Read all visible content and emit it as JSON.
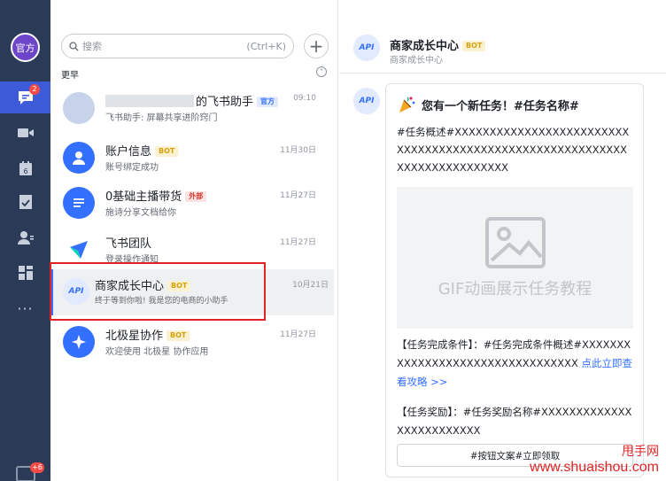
{
  "rail": {
    "avatar_text": "官方",
    "chat_badge": "2",
    "more_dots": "···",
    "bottom_badge": "+6"
  },
  "list": {
    "search_placeholder": "搜索",
    "search_shortcut": "(Ctrl+K)",
    "add_symbol": "+",
    "section_label": "更早",
    "items": [
      {
        "name": "的飞书助手",
        "tag": "官方",
        "preview": "飞书助手: 屏幕共享进阶窍门",
        "time": "09:10"
      },
      {
        "name": "账户信息",
        "tag": "BOT",
        "preview": "账号绑定成功",
        "time": "11月30日"
      },
      {
        "name": "0基础主播带货",
        "tag": "外部",
        "preview": "施诗分享文档给你",
        "time": "11月27日"
      },
      {
        "name": "飞书团队",
        "tag": "",
        "preview": "登录操作通知",
        "time": "11月27日"
      },
      {
        "name": "商家成长中心",
        "tag": "BOT",
        "preview": "终于等到你啦! 我是您的电商的小助手",
        "time": "10月21日"
      },
      {
        "name": "北极星协作",
        "tag": "BOT",
        "preview": "欢迎使用 北极星 协作应用",
        "time": "11月27日"
      }
    ]
  },
  "chat": {
    "avatar_text": "API",
    "title": "商家成长中心",
    "title_tag": "BOT",
    "subtitle": "商家成长中心",
    "card": {
      "title": "您有一个新任务！#任务名称#",
      "overview": "#任务概述#XXXXXXXXXXXXXXXXXXXXXXXXXXXXXXXXXXXXXXXXXXXXXXXXXXXXXXXXXXXXXXXXXXXXXXXXXX",
      "gif_text": "GIF动画展示任务教程",
      "condition_label": "【任务完成条件】：#任务完成条件概述#XXXXXXXXXXXXXXXXXXXXXXXXXXXXXXXXX",
      "condition_link": "点此立即查看攻略 >>",
      "reward_label": "【任务奖励】：#任务奖励名称#XXXXXXXXXXXXXXXXXXXXXXXXX",
      "button_label": "#按钮文案#立即领取"
    }
  },
  "watermark": {
    "line1": "甩手网",
    "line2": "www.shuaishou.com"
  }
}
